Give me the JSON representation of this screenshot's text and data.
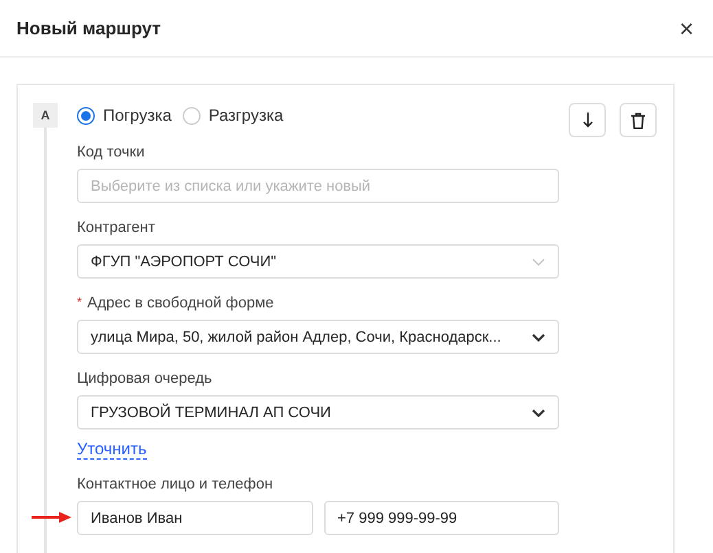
{
  "dialog": {
    "title": "Новый маршрут",
    "close": "×"
  },
  "point": {
    "badge": "A",
    "operations": [
      {
        "label": "Погрузка",
        "selected": true
      },
      {
        "label": "Разгрузка",
        "selected": false
      }
    ],
    "fields": [
      {
        "kind": "input",
        "label": "Код точки",
        "placeholder": "Выберите из списка или укажите новый"
      },
      {
        "kind": "combobox",
        "label": "Контрагент",
        "value": "ФГУП \"АЭРОПОРТ СОЧИ\""
      },
      {
        "kind": "select",
        "label": "Адрес в свободной форме",
        "required_mark": "*",
        "value": "улица Мира, 50, жилой район Адлер, Сочи, Краснодарск..."
      },
      {
        "kind": "select",
        "label": "Цифровая очередь",
        "value": "ГРУЗОВОЙ ТЕРМИНАЛ АП СОЧИ"
      }
    ],
    "link": "Уточнить",
    "contact": {
      "label": "Контактное лицо и телефон",
      "name": "Иванов Иван",
      "phone": "+7 999 999-99-99"
    }
  }
}
